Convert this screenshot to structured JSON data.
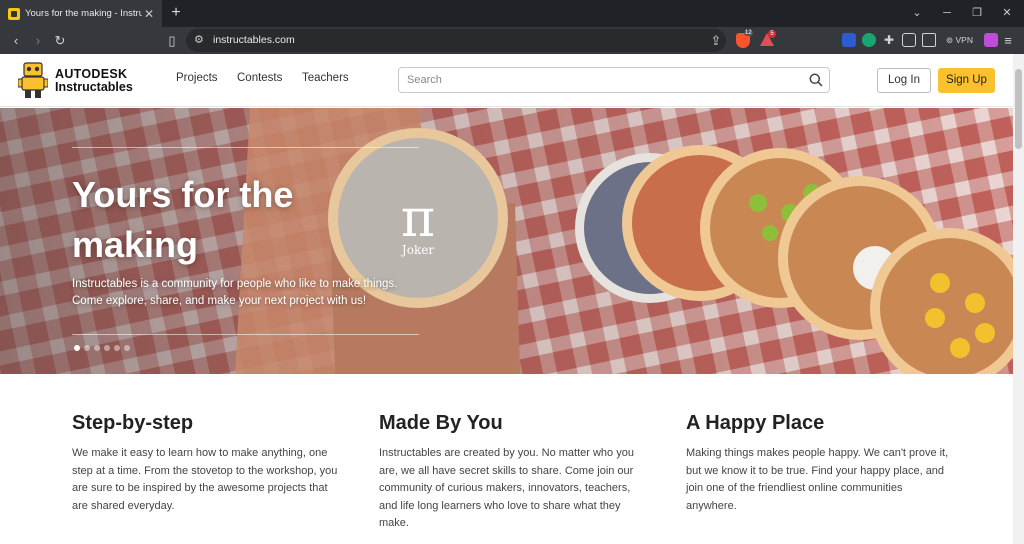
{
  "browser": {
    "tab_title": "Yours for the making - Instructables",
    "url": "instructables.com",
    "vpn_label": "VPN",
    "brave_badge": "12",
    "rewards_badge": "5",
    "icons": {
      "back": "back-arrow-icon",
      "forward": "forward-arrow-icon",
      "reload": "reload-icon",
      "bookmark": "bookmark-icon",
      "share": "share-icon"
    }
  },
  "header": {
    "brand_line1": "AUTODESK",
    "brand_line2": "Instructables",
    "nav": [
      "Projects",
      "Contests",
      "Teachers"
    ],
    "search_placeholder": "Search",
    "login_label": "Log In",
    "signup_label": "Sign Up",
    "signup_color": "#fbc02d"
  },
  "hero": {
    "title": "Yours for the making",
    "subtitle": "Instructables is a community for people who like to make things. Come explore, share, and make your next project with us!",
    "slide_count": 6,
    "active_slide": 1
  },
  "features": [
    {
      "title": "Step-by-step",
      "text": "We make it easy to learn how to make anything, one step at a time. From the stovetop to the workshop, you are sure to be inspired by the awesome projects that are shared everyday."
    },
    {
      "title": "Made By You",
      "text": "Instructables are created by you. No matter who you are, we all have secret skills to share. Come join our community of curious makers, innovators, teachers, and life long learners who love to share what they make."
    },
    {
      "title": "A Happy Place",
      "text": "Making things makes people happy. We can't prove it, but we know it to be true. Find your happy place, and join one of the friendliest online communities anywhere."
    }
  ]
}
